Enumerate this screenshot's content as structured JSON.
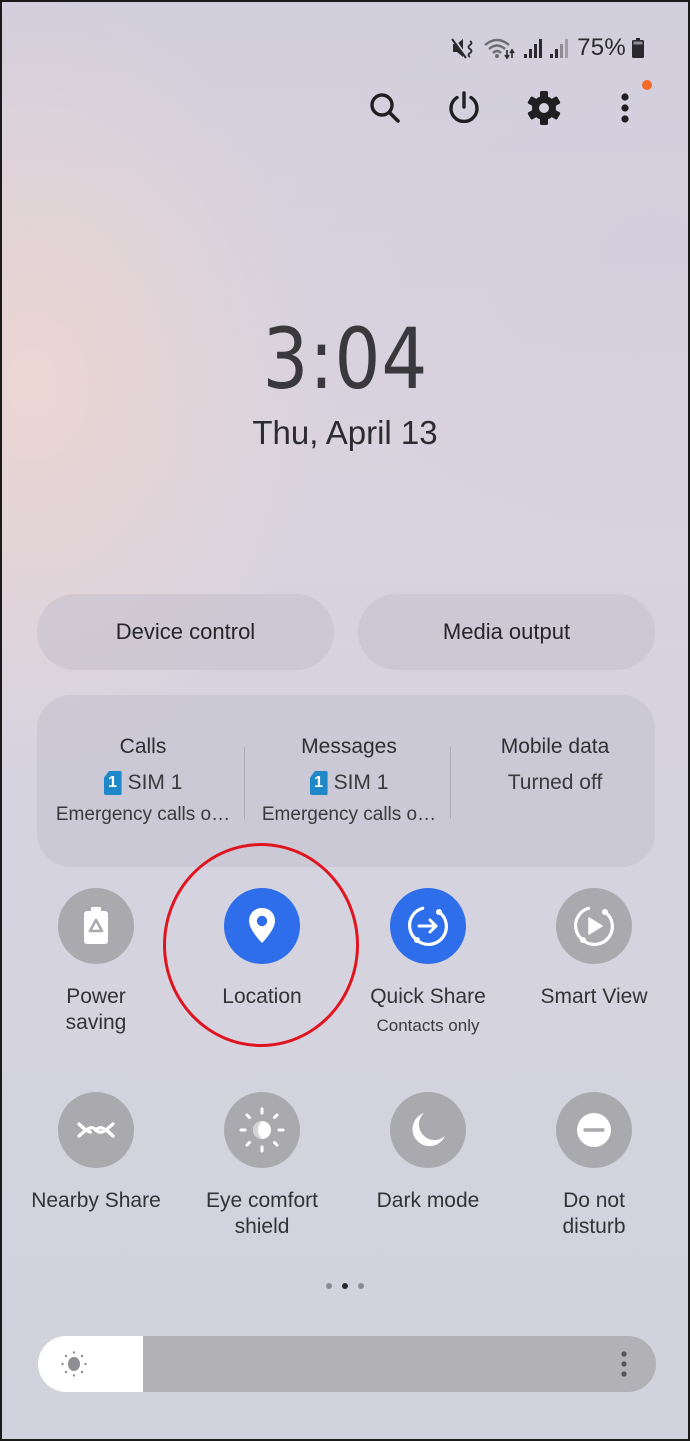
{
  "status_bar": {
    "icons": [
      "mute-vibrate-icon",
      "wifi-data-activity-icon",
      "signal-sim1-icon",
      "signal-sim2-icon",
      "battery-icon"
    ],
    "battery_percent": "75%"
  },
  "top_actions": [
    {
      "name": "search",
      "icon": "search-icon"
    },
    {
      "name": "power",
      "icon": "power-icon"
    },
    {
      "name": "settings",
      "icon": "gear-icon"
    },
    {
      "name": "more-options",
      "icon": "more-vertical-icon",
      "has_notification_dot": true
    }
  ],
  "clock": {
    "time": "3:04",
    "date": "Thu, April 13"
  },
  "pills": {
    "device_control": "Device control",
    "media_output": "Media output"
  },
  "sim_panel": {
    "columns": [
      {
        "title": "Calls",
        "sim_number": "1",
        "sim_label": "SIM 1",
        "sub": "Emergency calls o…"
      },
      {
        "title": "Messages",
        "sim_number": "1",
        "sim_label": "SIM 1",
        "sub": "Emergency calls o…"
      },
      {
        "title": "Mobile data",
        "status": "Turned off"
      }
    ]
  },
  "tiles": [
    {
      "label": "Power\nsaving",
      "line1": "Power",
      "line2": "saving",
      "icon": "battery-saver-icon",
      "on": false
    },
    {
      "label": "Location",
      "icon": "location-pin-icon",
      "on": true,
      "highlighted": true
    },
    {
      "label": "Quick Share",
      "sublabel": "Contacts only",
      "icon": "quick-share-icon",
      "on": true
    },
    {
      "label": "Smart View",
      "icon": "smart-view-icon",
      "on": false
    },
    {
      "label": "Nearby Share",
      "icon": "nearby-share-icon",
      "on": false
    },
    {
      "line1": "Eye comfort",
      "line2": "shield",
      "icon": "eye-comfort-icon",
      "on": false
    },
    {
      "label": "Dark mode",
      "icon": "moon-icon",
      "on": false
    },
    {
      "line1": "Do not",
      "line2": "disturb",
      "icon": "do-not-disturb-icon",
      "on": false
    }
  ],
  "page_indicator": {
    "total": 3,
    "current": 2
  },
  "brightness": {
    "level_percent": 17
  },
  "colors": {
    "accent_on": "#2f6eea",
    "tile_off": "#a9a9ae",
    "highlight_ring": "#e0141e",
    "notification_dot": "#f26b2a",
    "sim_badge": "#1e88c8"
  }
}
